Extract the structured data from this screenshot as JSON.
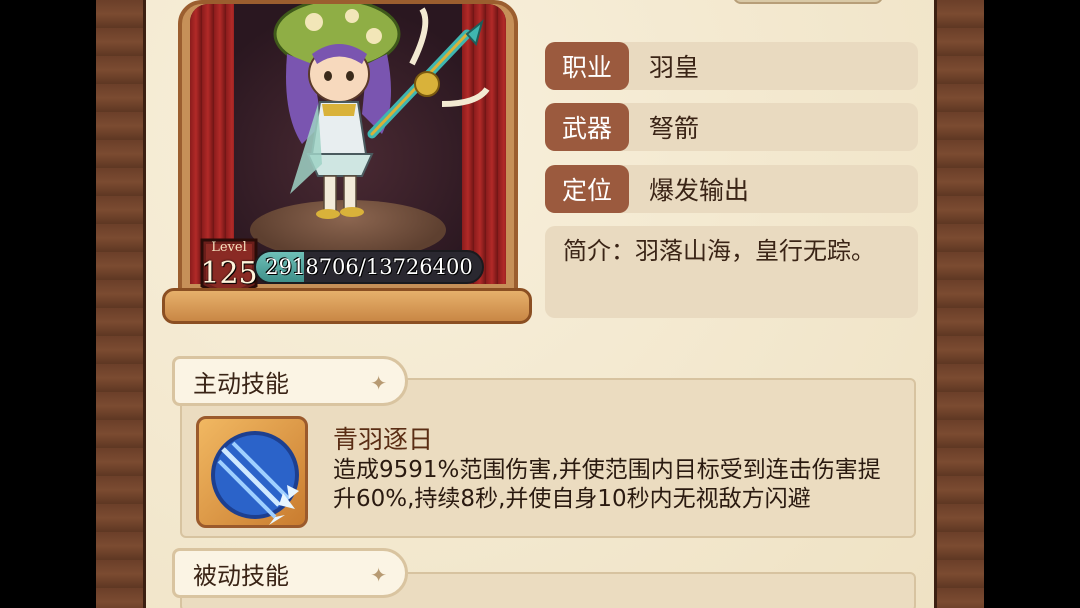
{
  "hero": {
    "level_label": "Level",
    "level": "125",
    "exp_current": 2918706,
    "exp_max": 13726400,
    "exp_text": "2918706/13726400",
    "exp_fraction": 0.213
  },
  "info": {
    "class_label": "职业",
    "class_value": "羽皇",
    "weapon_label": "武器",
    "weapon_value": "弩箭",
    "role_label": "定位",
    "role_value": "爆发输出",
    "intro_text": "简介：羽落山海，皇行无踪。"
  },
  "active_skill": {
    "section_title": "主动技能",
    "name": "青羽逐日",
    "description": "造成9591%范围伤害,并使范围内目标受到连击伤害提升60%,持续8秒,并使自身10秒内无视敌方闪避",
    "icon": "arrow-volley-icon"
  },
  "passive_skill": {
    "section_title": "被动技能"
  },
  "colors": {
    "label_bg": "#9b5a3e",
    "panel_bg": "#e9dac0",
    "paper": "#f4ead3",
    "frame": "#6b3f29"
  }
}
